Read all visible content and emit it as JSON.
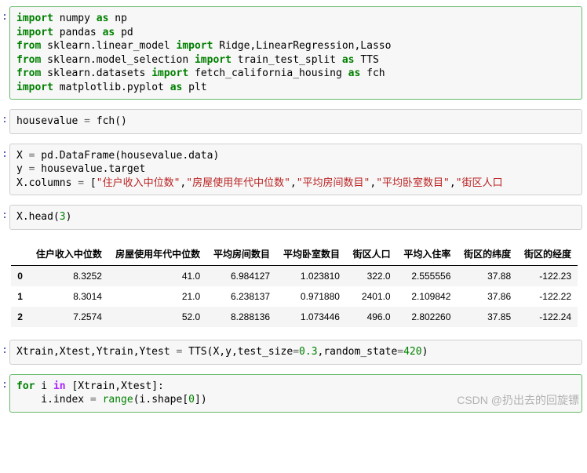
{
  "cells": {
    "c1": {
      "lines": [
        [
          [
            "kw",
            "import"
          ],
          [
            "nm",
            " numpy "
          ],
          [
            "kw",
            "as"
          ],
          [
            "nm",
            " np"
          ]
        ],
        [
          [
            "kw",
            "import"
          ],
          [
            "nm",
            " pandas "
          ],
          [
            "kw",
            "as"
          ],
          [
            "nm",
            " pd"
          ]
        ],
        [
          [
            "kw",
            "from"
          ],
          [
            "nm",
            " sklearn.linear_model "
          ],
          [
            "kw",
            "import"
          ],
          [
            "nm",
            " Ridge,LinearRegression,Lasso"
          ]
        ],
        [
          [
            "kw",
            "from"
          ],
          [
            "nm",
            " sklearn.model_selection "
          ],
          [
            "kw",
            "import"
          ],
          [
            "nm",
            " train_test_split "
          ],
          [
            "kw",
            "as"
          ],
          [
            "nm",
            " TTS"
          ]
        ],
        [
          [
            "kw",
            "from"
          ],
          [
            "nm",
            " sklearn.datasets "
          ],
          [
            "kw",
            "import"
          ],
          [
            "nm",
            " fetch_california_housing "
          ],
          [
            "kw",
            "as"
          ],
          [
            "nm",
            " fch"
          ]
        ],
        [
          [
            "kw",
            "import"
          ],
          [
            "nm",
            " matplotlib.pyplot "
          ],
          [
            "kw",
            "as"
          ],
          [
            "nm",
            " plt"
          ]
        ]
      ]
    },
    "c2": {
      "lines": [
        [
          [
            "nm",
            "housevalue "
          ],
          [
            "assign",
            "="
          ],
          [
            "nm",
            " fch()"
          ]
        ]
      ]
    },
    "c3": {
      "lines": [
        [
          [
            "nm",
            "X "
          ],
          [
            "assign",
            "="
          ],
          [
            "nm",
            " pd.DataFrame(housevalue.data)"
          ]
        ],
        [
          [
            "nm",
            "y "
          ],
          [
            "assign",
            "="
          ],
          [
            "nm",
            " housevalue.target"
          ]
        ],
        [
          [
            "nm",
            "X.columns "
          ],
          [
            "assign",
            "="
          ],
          [
            "nm",
            " ["
          ],
          [
            "str",
            "\"住户收入中位数\""
          ],
          [
            "nm",
            ","
          ],
          [
            "str",
            "\"房屋使用年代中位数\""
          ],
          [
            "nm",
            ","
          ],
          [
            "str",
            "\"平均房间数目\""
          ],
          [
            "nm",
            ","
          ],
          [
            "str",
            "\"平均卧室数目\""
          ],
          [
            "nm",
            ","
          ],
          [
            "str",
            "\"街区人口"
          ]
        ]
      ]
    },
    "c4": {
      "lines": [
        [
          [
            "nm",
            "X.head("
          ],
          [
            "num",
            "3"
          ],
          [
            "nm",
            ")"
          ]
        ]
      ]
    },
    "c5": {
      "lines": [
        [
          [
            "nm",
            "Xtrain,Xtest,Ytrain,Ytest "
          ],
          [
            "assign",
            "="
          ],
          [
            "nm",
            " TTS(X,y,test_size"
          ],
          [
            "assign",
            "="
          ],
          [
            "num",
            "0.3"
          ],
          [
            "nm",
            ",random_state"
          ],
          [
            "assign",
            "="
          ],
          [
            "num",
            "420"
          ],
          [
            "nm",
            ")"
          ]
        ]
      ]
    },
    "c6": {
      "lines": [
        [
          [
            "kw",
            "for"
          ],
          [
            "nm",
            " i "
          ],
          [
            "op",
            "in"
          ],
          [
            "nm",
            " [Xtrain,Xtest]:"
          ]
        ],
        [
          [
            "nm",
            "    i.index "
          ],
          [
            "assign",
            "="
          ],
          [
            "nm",
            " "
          ],
          [
            "bi",
            "range"
          ],
          [
            "nm",
            "(i.shape["
          ],
          [
            "num",
            "0"
          ],
          [
            "nm",
            "])"
          ]
        ]
      ]
    }
  },
  "table": {
    "columns": [
      "住户收入中位数",
      "房屋使用年代中位数",
      "平均房间数目",
      "平均卧室数目",
      "街区人口",
      "平均入住率",
      "街区的纬度",
      "街区的经度"
    ],
    "index": [
      "0",
      "1",
      "2"
    ],
    "rows": [
      [
        "8.3252",
        "41.0",
        "6.984127",
        "1.023810",
        "322.0",
        "2.555556",
        "37.88",
        "-122.23"
      ],
      [
        "8.3014",
        "21.0",
        "6.238137",
        "0.971880",
        "2401.0",
        "2.109842",
        "37.86",
        "-122.22"
      ],
      [
        "7.2574",
        "52.0",
        "8.288136",
        "1.073446",
        "496.0",
        "2.802260",
        "37.85",
        "-122.24"
      ]
    ]
  },
  "watermark": "CSDN @扔出去的回旋镖",
  "prompt_char": ":"
}
